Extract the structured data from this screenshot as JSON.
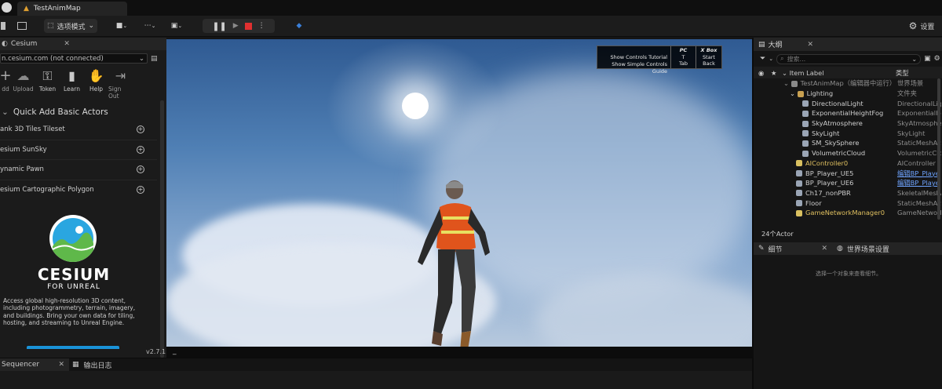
{
  "window": {
    "tab_title": "TestAnimMap"
  },
  "toolbar": {
    "mode_label": "选项模式",
    "settings_label": "设置"
  },
  "cesium_panel": {
    "tab_label": "Cesium",
    "server": "n.cesium.com (not connected)",
    "buttons": [
      "dd",
      "Upload",
      "Token",
      "Learn",
      "Help",
      "Sign Out"
    ],
    "quick_add_title": "Quick Add Basic Actors",
    "quick_add_items": [
      "ank 3D Tiles Tileset",
      "esium SunSky",
      "ynamic Pawn",
      "esium Cartographic Polygon"
    ],
    "logo_title": "CESIUM",
    "logo_subtitle": "FOR UNREAL",
    "description": "Access global high-resolution 3D content, including photogrammetry, terrain, imagery, and buildings. Bring your own data for tiling, hosting, and streaming to Unreal Engine.",
    "version": "v2.7.1"
  },
  "viewport": {
    "controls": {
      "lines": [
        "Show Controls Tutorial",
        "Show Simple Controls Guide"
      ],
      "pc": [
        "PC",
        "T",
        "Tab"
      ],
      "xbox": [
        "X Box",
        "Start",
        "Back"
      ]
    }
  },
  "outliner": {
    "tab_label": "大纲",
    "search_placeholder": "搜索...",
    "col_label": "Item Label",
    "col_type": "类型",
    "rows": [
      {
        "name": "TestAnimMap（编辑器中运行）",
        "type": "世界场景"
      },
      {
        "name": "Lighting",
        "type": "文件夹"
      },
      {
        "name": "DirectionalLight",
        "type": "DirectionalLigh"
      },
      {
        "name": "ExponentialHeightFog",
        "type": "ExponentialHe"
      },
      {
        "name": "SkyAtmosphere",
        "type": "SkyAtmosphe"
      },
      {
        "name": "SkyLight",
        "type": "SkyLight"
      },
      {
        "name": "SM_SkySphere",
        "type": "StaticMeshAct"
      },
      {
        "name": "VolumetricCloud",
        "type": "VolumetricClou"
      },
      {
        "name": "AIController0",
        "type": "AIController"
      },
      {
        "name": "BP_Player_UE5",
        "type": "编辑BP_Playe"
      },
      {
        "name": "BP_Player_UE6",
        "type": "编辑BP_Playe"
      },
      {
        "name": "Ch17_nonPBR",
        "type": "SkeletalMeshA"
      },
      {
        "name": "Floor",
        "type": "StaticMeshAct"
      },
      {
        "name": "GameNetworkManager0",
        "type": "GameNetwork"
      }
    ],
    "count": "24个Actor"
  },
  "details": {
    "tab_details": "细节",
    "tab_world": "世界场景设置",
    "empty_msg": "选择一个对象来查看细节。"
  },
  "bottom": {
    "tab_sequencer": "Sequencer",
    "tab_log": "输出日志"
  },
  "colors": {
    "accent": "#1a93d8",
    "link": "#6fa4ff",
    "stop": "#e03030"
  }
}
